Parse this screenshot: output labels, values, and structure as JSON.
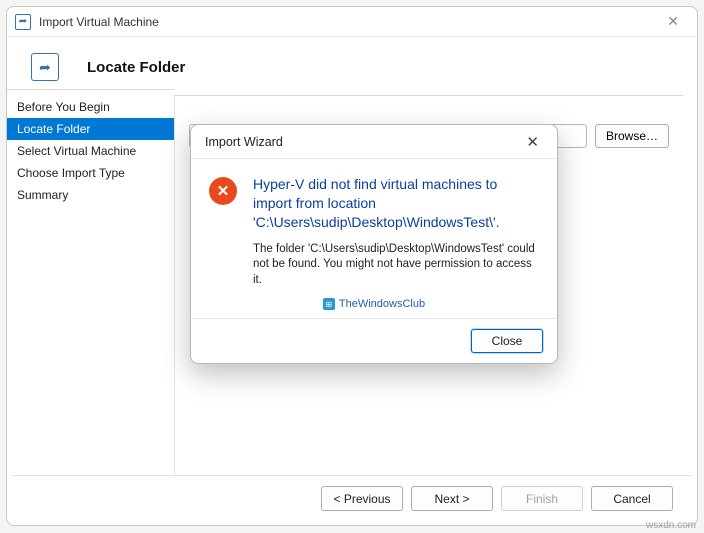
{
  "window": {
    "title": "Import Virtual Machine",
    "page_title": "Locate Folder"
  },
  "sidebar": {
    "items": [
      {
        "label": "Before You Begin"
      },
      {
        "label": "Locate Folder"
      },
      {
        "label": "Select Virtual Machine"
      },
      {
        "label": "Choose Import Type"
      },
      {
        "label": "Summary"
      }
    ],
    "selected_index": 1
  },
  "content": {
    "browse_label": "Browse…",
    "path_value": ""
  },
  "footer": {
    "previous": "< Previous",
    "next": "Next >",
    "finish": "Finish",
    "cancel": "Cancel"
  },
  "dialog": {
    "title": "Import Wizard",
    "main_message": "Hyper-V did not find virtual machines to import from location 'C:\\Users\\sudip\\Desktop\\WindowsTest\\'.",
    "sub_message": "The folder 'C:\\Users\\sudip\\Desktop\\WindowsTest' could not be found. You might not have permission to access it.",
    "close_label": "Close",
    "watermark": "TheWindowsClub"
  },
  "attribution": "wsxdn.com"
}
